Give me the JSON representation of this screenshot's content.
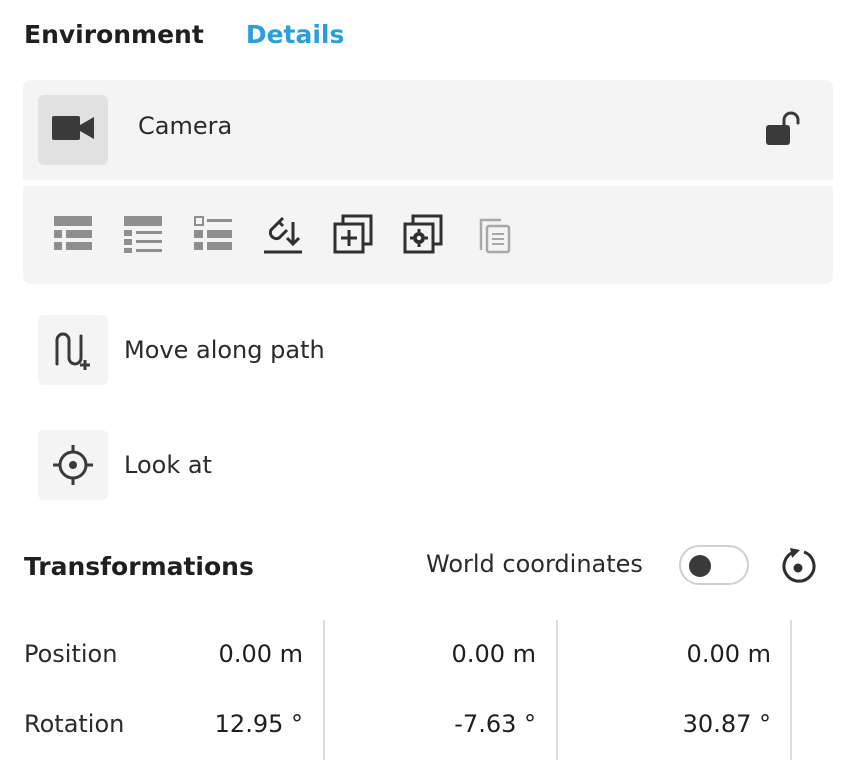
{
  "tabs": {
    "environment": "Environment",
    "details": "Details"
  },
  "object": {
    "name": "Camera",
    "icon": "video-camera-icon",
    "lock_icon": "unlock-icon"
  },
  "toolbar": {
    "tools": [
      "list-view-icon",
      "list-detail-icon",
      "list-checkbox-icon",
      "magnet-snap-icon",
      "duplicate-add-icon",
      "duplicate-settings-icon",
      "paste-icon"
    ]
  },
  "actions": {
    "move_along_path": "Move along path",
    "look_at": "Look at"
  },
  "transformations": {
    "title": "Transformations",
    "world_coordinates_label": "World coordinates",
    "world_coordinates_enabled": false,
    "rows": [
      {
        "label": "Position",
        "values": [
          "0.00 m",
          "0.00 m",
          "0.00 m"
        ]
      },
      {
        "label": "Rotation",
        "values": [
          "12.95 °",
          "-7.63 °",
          "30.87 °"
        ]
      }
    ]
  },
  "colors": {
    "accent": "#2a9fd8",
    "card_bg": "#f4f4f4",
    "icon_dark": "#3a3a3a",
    "icon_disabled": "#a8a8a8"
  }
}
